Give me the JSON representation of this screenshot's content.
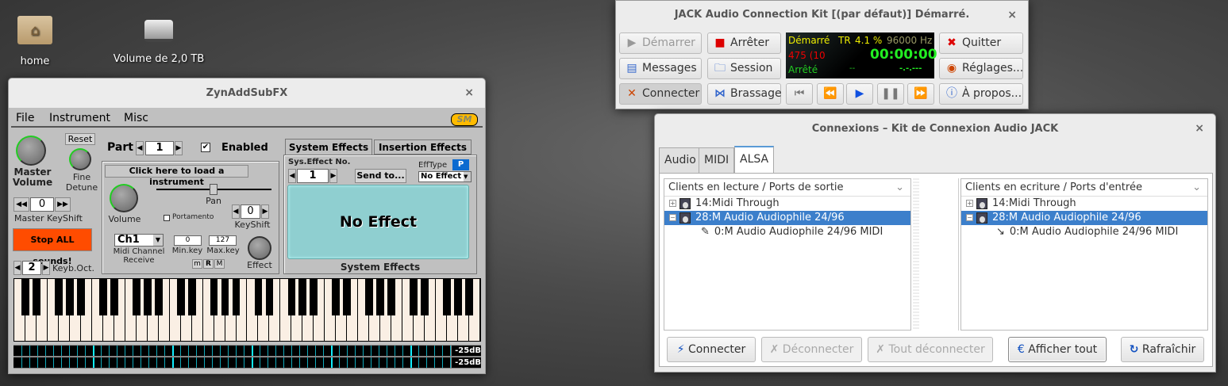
{
  "desktop": {
    "icons": [
      {
        "label": "home",
        "icon": "home-folder-icon"
      },
      {
        "label": "Volume de 2,0 TB",
        "icon": "hard-drive-icon"
      }
    ]
  },
  "zyn": {
    "title": "ZynAddSubFX",
    "menu": [
      "File",
      "Instrument",
      "Misc"
    ],
    "sm_badge": "SM",
    "master_volume_label": "Master Volume",
    "reset": "Reset",
    "fine_detune_label": "Fine Detune",
    "master_keyshift_value": "0",
    "master_keyshift_label": "Master KeyShift",
    "stop_all": "Stop ALL sounds!",
    "keyb_oct_value": "2",
    "keyb_oct_label": "Keyb.Oct.",
    "part_label": "Part",
    "part_value": "1",
    "enabled_label": "Enabled",
    "enabled_checked": true,
    "load_instrument": "Click here to load a instrument",
    "pan_label": "Pan",
    "volume_label": "Volume",
    "portamento_label": "Portamento",
    "keyshift_value": "0",
    "keyshift_label": "KeyShift",
    "midi_channel": "Ch1",
    "midi_channel_label": "Midi Channel Receive",
    "min_key_value": "0",
    "min_key_label": "Min.key",
    "max_key_value": "127",
    "max_key_label": "Max.key",
    "mode_buttons": [
      "m",
      "R",
      "M"
    ],
    "effect_label": "Effect",
    "fx_tabs": [
      "System Effects",
      "Insertion Effects"
    ],
    "sys_effect_no_label": "Sys.Effect No.",
    "sys_effect_no": "1",
    "send_to": "Send to...",
    "efftype_label": "EffType",
    "p_button": "P",
    "efftype_value": "No Effect",
    "no_effect": "No Effect",
    "fx_group_label": "System Effects",
    "keyboard_octaves": 6,
    "vu_labels": [
      "-25dB",
      "-25dB"
    ]
  },
  "jack": {
    "title": "JACK Audio Connection Kit [(par défaut)] Démarré.",
    "buttons": {
      "start": "Démarrer",
      "stop": "Arrêter",
      "quit": "Quitter",
      "messages": "Messages",
      "session": "Session",
      "settings": "Réglages...",
      "connect": "Connecter",
      "patchbay": "Brassage",
      "about": "À propos..."
    },
    "display": {
      "status": "Démarré",
      "tr": "TR",
      "dsp": "4.1 %",
      "rate": "96000 Hz",
      "xruns": "475 (10",
      "time": "00:00:00",
      "transport": "Arrêté",
      "bbt": "--",
      "tc": "-.-.---"
    },
    "transport": [
      "rewind-start",
      "rewind",
      "play",
      "pause",
      "fast-forward"
    ]
  },
  "conn": {
    "title": "Connexions – Kit de Connexion Audio JACK",
    "tabs": [
      "Audio",
      "MIDI",
      "ALSA"
    ],
    "active_tab": "ALSA",
    "left": {
      "header": "Clients en lecture / Ports de sortie",
      "rows": [
        {
          "label": "14:Midi Through",
          "exp": "+"
        },
        {
          "label": "28:M Audio Audiophile 24/96",
          "exp": "−",
          "selected": true
        },
        {
          "label": "0:M Audio Audiophile 24/96 MIDI",
          "port": true
        }
      ]
    },
    "right": {
      "header": "Clients en ecriture / Ports d'entrée",
      "rows": [
        {
          "label": "14:Midi Through",
          "exp": "+"
        },
        {
          "label": "28:M Audio Audiophile 24/96",
          "exp": "−",
          "selected": true
        },
        {
          "label": "0:M Audio Audiophile 24/96 MIDI",
          "port": true
        }
      ]
    },
    "buttons": {
      "connect": "Connecter",
      "disconnect": "Déconnecter",
      "disconnect_all": "Tout déconnecter",
      "show_all": "Afficher tout",
      "refresh": "Rafraîchir"
    }
  }
}
